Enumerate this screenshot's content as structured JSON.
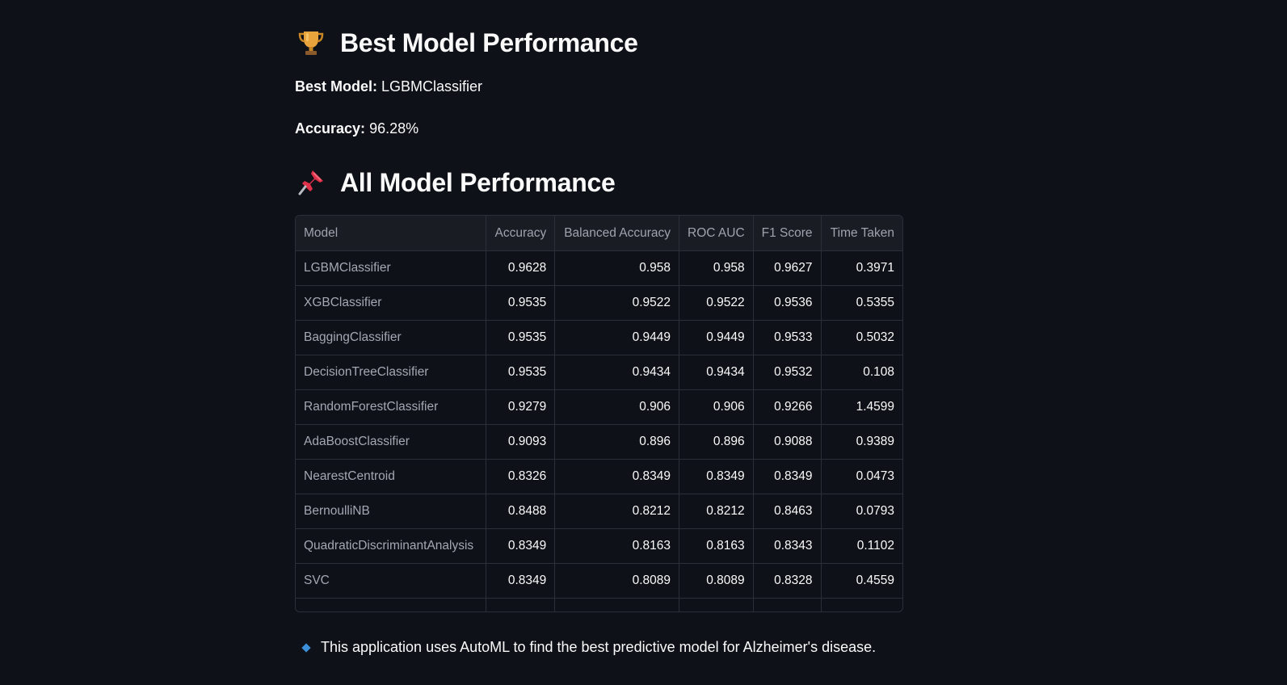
{
  "best_section": {
    "title": "Best Model Performance",
    "best_model_label": "Best Model:",
    "best_model_value": "LGBMClassifier",
    "accuracy_label": "Accuracy:",
    "accuracy_value": "96.28%",
    "icon": "trophy-icon"
  },
  "all_section": {
    "title": "All Model Performance",
    "icon": "pushpin-icon"
  },
  "table": {
    "columns": [
      "Model",
      "Accuracy",
      "Balanced Accuracy",
      "ROC AUC",
      "F1 Score",
      "Time Taken"
    ],
    "rows": [
      [
        "LGBMClassifier",
        "0.9628",
        "0.958",
        "0.958",
        "0.9627",
        "0.3971"
      ],
      [
        "XGBClassifier",
        "0.9535",
        "0.9522",
        "0.9522",
        "0.9536",
        "0.5355"
      ],
      [
        "BaggingClassifier",
        "0.9535",
        "0.9449",
        "0.9449",
        "0.9533",
        "0.5032"
      ],
      [
        "DecisionTreeClassifier",
        "0.9535",
        "0.9434",
        "0.9434",
        "0.9532",
        "0.108"
      ],
      [
        "RandomForestClassifier",
        "0.9279",
        "0.906",
        "0.906",
        "0.9266",
        "1.4599"
      ],
      [
        "AdaBoostClassifier",
        "0.9093",
        "0.896",
        "0.896",
        "0.9088",
        "0.9389"
      ],
      [
        "NearestCentroid",
        "0.8326",
        "0.8349",
        "0.8349",
        "0.8349",
        "0.0473"
      ],
      [
        "BernoulliNB",
        "0.8488",
        "0.8212",
        "0.8212",
        "0.8463",
        "0.0793"
      ],
      [
        "QuadraticDiscriminantAnalysis",
        "0.8349",
        "0.8163",
        "0.8163",
        "0.8343",
        "0.1102"
      ],
      [
        "SVC",
        "0.8349",
        "0.8089",
        "0.8089",
        "0.8328",
        "0.4559"
      ]
    ]
  },
  "note": {
    "icon": "blue-diamond-icon",
    "text": "This application uses AutoML to find the best predictive model for Alzheimer's disease."
  },
  "colors": {
    "background": "#0e1117",
    "text": "#fafafa",
    "table_border": "#2b2f38",
    "header_bg": "#1a1c24",
    "accent_diamond": "#3b8fd9"
  }
}
